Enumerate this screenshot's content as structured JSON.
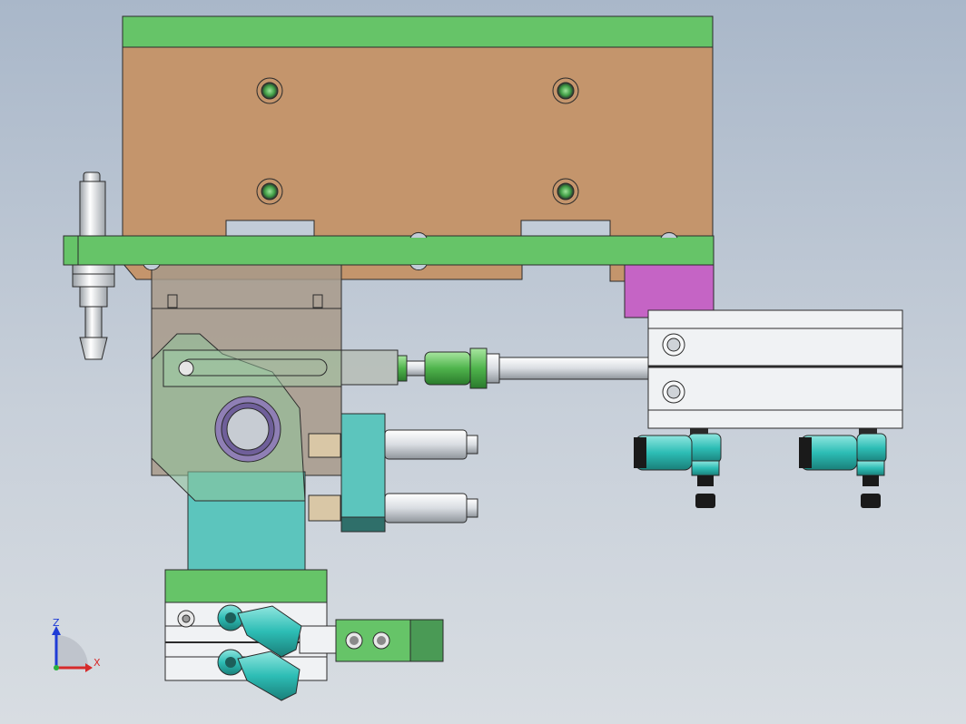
{
  "view": {
    "triad": {
      "z_label": "Z",
      "x_label": "X"
    }
  },
  "colors": {
    "green_plate": "#66c468",
    "brown_block": "#c4956c",
    "magenta_block": "#c564c5",
    "cyan_part": "#5cc5bd",
    "cylinder_body": "#f0f2f4",
    "fitting": "#2dbdb5",
    "dark_green": "#4a9a55",
    "outline": "#2b2b2b",
    "background_top": "#a9b7c9",
    "background_bottom": "#d8dde2"
  }
}
